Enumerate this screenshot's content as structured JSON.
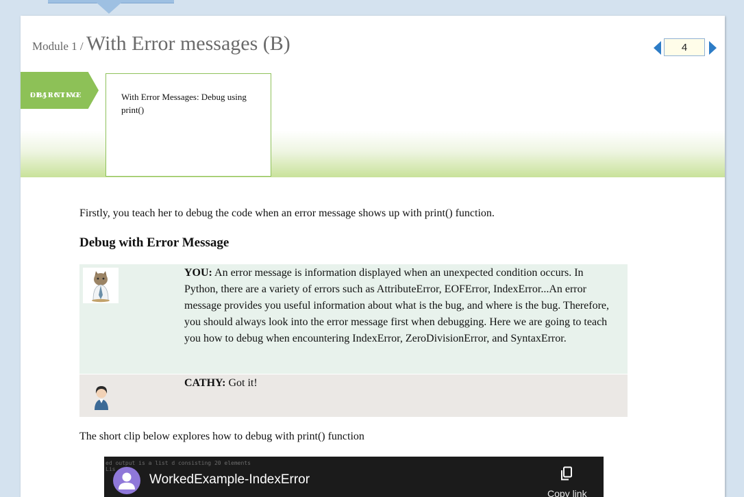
{
  "header": {
    "module": "Module 1 / ",
    "title": "With Error messages (B)"
  },
  "pager": {
    "page": "4"
  },
  "learning_objective": {
    "tag_line1": "LEARNING",
    "tag_line2": "OBJECTIVE",
    "text": "With Error Messages: Debug using print()"
  },
  "content": {
    "intro": "Firstly, you teach her to debug the code when an error message shows up with print() function.",
    "heading": "Debug with Error Message",
    "dialogue": [
      {
        "speaker": "YOU:",
        "text": " An error message is information displayed when an unexpected condition occurs. In Python, there are a variety of errors such as AttributeError, EOFError, IndexError...An error message provides you useful information about what is the bug, and where is the bug. Therefore, you should always look into the error message first when debugging. Here we are going to teach you how to debug when encountering IndexError, ZeroDivisionError, and SyntaxError."
      },
      {
        "speaker": "CATHY:",
        "text": " Got it!"
      }
    ],
    "clip_intro": "The short clip below explores how to debug with print() function"
  },
  "video": {
    "terminal_line1": "ed output is a list d consisting 20 elements",
    "terminal_line2": "Lis",
    "title": "WorkedExample-IndexError",
    "copy_label": "Copy link"
  },
  "colors": {
    "accent_blue": "#2d7cc6",
    "objective_green": "#8dc157",
    "you_bg": "#e8f2ec",
    "cathy_bg": "#ebe8e5"
  }
}
